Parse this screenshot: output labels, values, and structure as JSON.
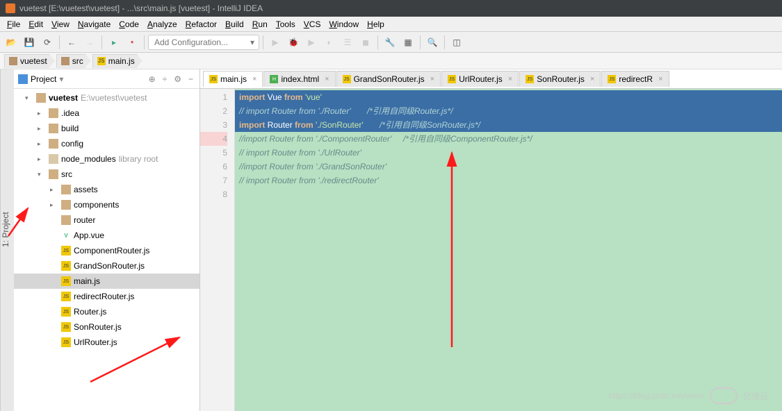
{
  "title": "vuetest [E:\\vuetest\\vuetest] - ...\\src\\main.js [vuetest] - IntelliJ IDEA",
  "menus": [
    "File",
    "Edit",
    "View",
    "Navigate",
    "Code",
    "Analyze",
    "Refactor",
    "Build",
    "Run",
    "Tools",
    "VCS",
    "Window",
    "Help"
  ],
  "addConfig": "Add Configuration...",
  "breadcrumbs": [
    {
      "icon": "folder",
      "label": "vuetest"
    },
    {
      "icon": "folder",
      "label": "src"
    },
    {
      "icon": "js",
      "label": "main.js"
    }
  ],
  "projectLabel": "Project",
  "tree": {
    "root": {
      "label": "vuetest",
      "suffix": " E:\\vuetest\\vuetest"
    },
    "items": [
      {
        "lvl": 2,
        "arrow": "▸",
        "icon": "folder",
        "label": ".idea"
      },
      {
        "lvl": 2,
        "arrow": "▸",
        "icon": "folder",
        "label": "build"
      },
      {
        "lvl": 2,
        "arrow": "▸",
        "icon": "folder",
        "label": "config"
      },
      {
        "lvl": 2,
        "arrow": "▸",
        "icon": "librf",
        "label": "node_modules",
        "lib": "library root"
      },
      {
        "lvl": 2,
        "arrow": "▾",
        "icon": "folder",
        "label": "src"
      },
      {
        "lvl": 3,
        "arrow": "▸",
        "icon": "folder",
        "label": "assets"
      },
      {
        "lvl": 3,
        "arrow": "▸",
        "icon": "folder",
        "label": "components"
      },
      {
        "lvl": 3,
        "arrow": "",
        "icon": "folder",
        "label": "router"
      },
      {
        "lvl": 3,
        "arrow": "",
        "icon": "vue",
        "label": "App.vue"
      },
      {
        "lvl": 3,
        "arrow": "",
        "icon": "js",
        "label": "ComponentRouter.js"
      },
      {
        "lvl": 3,
        "arrow": "",
        "icon": "js",
        "label": "GrandSonRouter.js"
      },
      {
        "lvl": 3,
        "arrow": "",
        "icon": "js",
        "label": "main.js",
        "selected": true
      },
      {
        "lvl": 3,
        "arrow": "",
        "icon": "js",
        "label": "redirectRouter.js"
      },
      {
        "lvl": 3,
        "arrow": "",
        "icon": "js",
        "label": "Router.js"
      },
      {
        "lvl": 3,
        "arrow": "",
        "icon": "js",
        "label": "SonRouter.js"
      },
      {
        "lvl": 3,
        "arrow": "",
        "icon": "js",
        "label": "UrlRouter.js"
      }
    ]
  },
  "editorTabs": [
    {
      "icon": "js",
      "label": "main.js",
      "active": true
    },
    {
      "icon": "html",
      "label": "index.html"
    },
    {
      "icon": "js",
      "label": "GrandSonRouter.js"
    },
    {
      "icon": "js",
      "label": "UrlRouter.js"
    },
    {
      "icon": "js",
      "label": "SonRouter.js"
    },
    {
      "icon": "js",
      "label": "redirectR"
    }
  ],
  "code": {
    "lines": [
      {
        "n": 1,
        "sel": true,
        "html": "<span class='kw'>import</span> Vue <span class='kw'>from</span> <span class='str'>'vue'</span>"
      },
      {
        "n": 2,
        "sel": true,
        "html": "<span class='cmt'>// import Router from './Router'       /*引用自同级Router.js*/</span>"
      },
      {
        "n": 3,
        "sel": true,
        "html": "<span class='kw'>import</span> Router <span class='kw'>from</span> <span class='str'>'./SonRouter'</span>       <span class='cmt'>/*引用自同级SonRouter.js*/</span>"
      },
      {
        "n": 4,
        "err": true,
        "html": "<span class='cmt'>//import Router from './ComponentRouter'     /*引用自同级ComponentRouter.js*/</span>"
      },
      {
        "n": 5,
        "html": "<span class='cmt'>// import Router from './UrlRouter'</span>"
      },
      {
        "n": 6,
        "html": "<span class='cmt'>//import Router from './GrandSonRouter'</span>"
      },
      {
        "n": 7,
        "html": "<span class='cmt'>// import Router from './redirectRouter'</span>"
      },
      {
        "n": 8,
        "html": ""
      }
    ]
  },
  "watermark": {
    "text": "https://blog.csdn.net/weixi",
    "brand": "亿速云"
  },
  "sideTabLabel": "1: Project"
}
